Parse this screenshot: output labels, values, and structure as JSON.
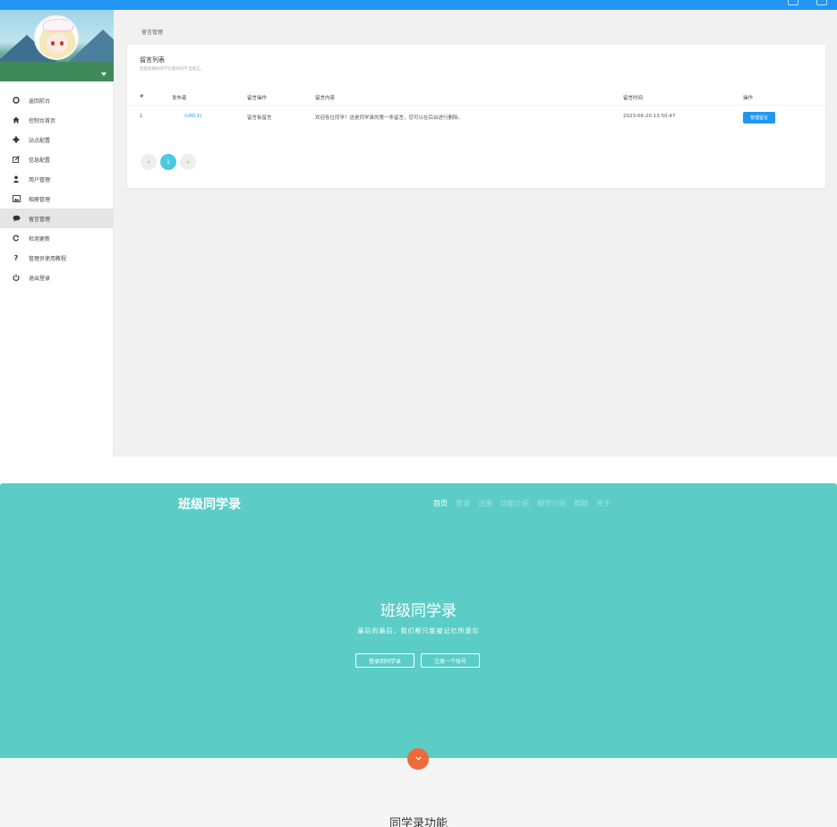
{
  "admin": {
    "breadcrumb": "留言管理",
    "nav": [
      {
        "label": "返回前台",
        "icon": "circle-icon"
      },
      {
        "label": "控制台首页",
        "icon": "home-icon"
      },
      {
        "label": "站点配置",
        "icon": "gear-icon"
      },
      {
        "label": "信息配置",
        "icon": "edit-icon"
      },
      {
        "label": "用户管理",
        "icon": "user-icon"
      },
      {
        "label": "相册管理",
        "icon": "image-icon"
      },
      {
        "label": "留言管理",
        "icon": "comment-icon"
      },
      {
        "label": "检测更新",
        "icon": "refresh-icon"
      },
      {
        "label": "管理员使用教程",
        "icon": "question-icon"
      },
      {
        "label": "退出登录",
        "icon": "power-icon"
      }
    ],
    "active_nav": "留言管理",
    "card": {
      "title": "留言列表",
      "subtitle": "您能够删除同学们发布的不当留言。",
      "headers": [
        "#",
        "发布者",
        "留言操作",
        "留言内容",
        "留言时间",
        "操作"
      ],
      "rows": [
        {
          "id": "1",
          "author": "(UID:1)",
          "action": "留言板留言",
          "content": "欢迎各位同学！这是同学录的第一条留言，您可以在后台进行删除。",
          "time": "2023-06-20 13:50:47",
          "op_label": "管理留言"
        }
      ]
    },
    "pager": {
      "prev": "«",
      "current": "1",
      "next": "»"
    }
  },
  "landing": {
    "brand": "班级同学录",
    "nav": [
      "首页",
      "登录",
      "注册",
      "功能介绍",
      "细节介绍",
      "帮助",
      "关于"
    ],
    "hero_title": "班级同学录",
    "hero_subtitle": "最后的最后，我们都只能被记忆所遗忘",
    "btn_login": "登录到同学录",
    "btn_register": "注册一个账号",
    "section_title": "同学录功能"
  },
  "colors": {
    "topbar": "#2196f3",
    "accent_button": "#2196f3",
    "pager_active": "#4cc8e0",
    "hero_bg": "#5bcdc6",
    "scroll_button": "#ef6a3a"
  }
}
